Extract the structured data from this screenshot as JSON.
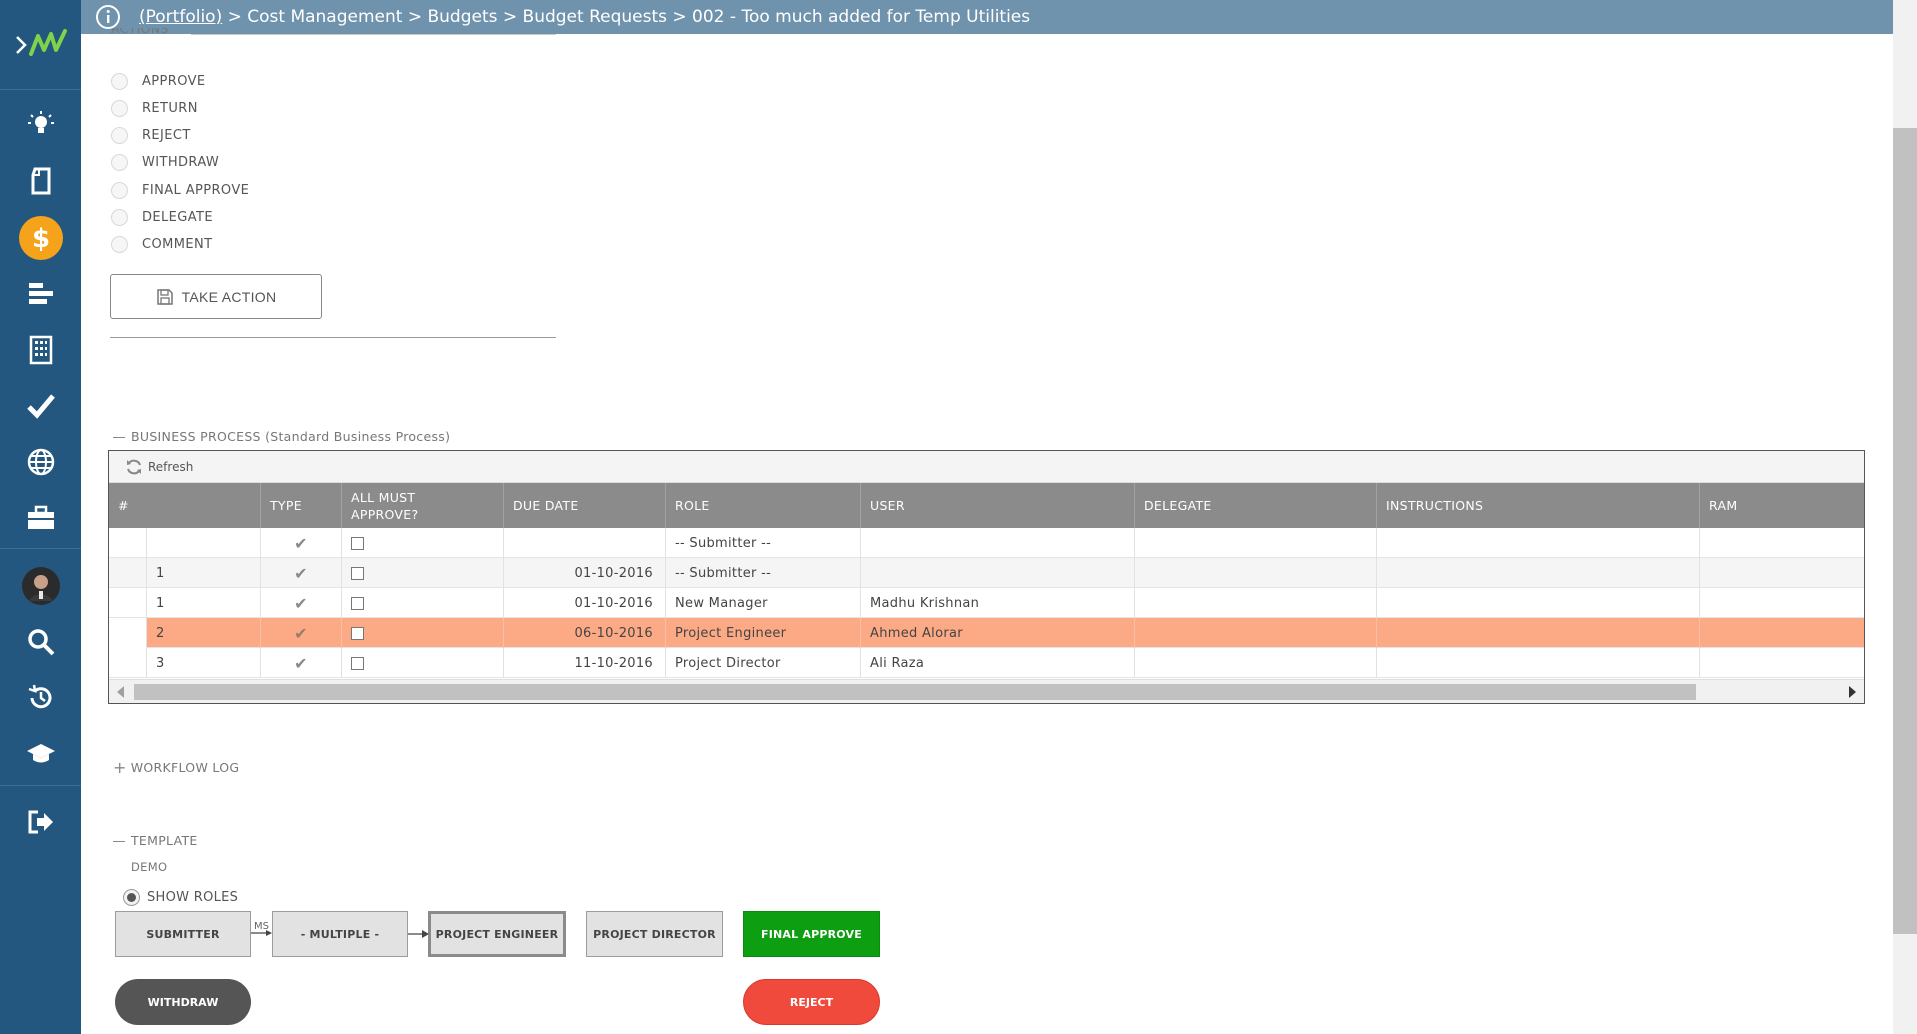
{
  "header": {
    "breadcrumb_link": "(Portfolio)",
    "breadcrumb_rest": " > Cost Management > Budgets > Budget Requests > 002 - Too much added for Temp Utilities"
  },
  "sidebar": {
    "items": [
      "logo-icon",
      "lightbulb-icon",
      "document-icon",
      "dollar-icon",
      "gantt-icon",
      "building-icon",
      "check-icon",
      "globe-icon",
      "briefcase-icon",
      "avatar",
      "search-icon",
      "history-icon",
      "graduation-cap-icon",
      "logout-icon"
    ],
    "accent": "#f5a31a"
  },
  "actions": {
    "section_label": "ACTIONS",
    "options": [
      "APPROVE",
      "RETURN",
      "REJECT",
      "WITHDRAW",
      "FINAL APPROVE",
      "DELEGATE",
      "COMMENT"
    ],
    "take_action_label": "TAKE ACTION"
  },
  "business_process": {
    "section_label": "BUSINESS PROCESS (Standard Business Process)",
    "refresh_label": "Refresh",
    "columns": [
      "#",
      "TYPE",
      "ALL MUST APPROVE?",
      "DUE DATE",
      "ROLE",
      "USER",
      "DELEGATE",
      "INSTRUCTIONS",
      "RAM"
    ],
    "rows": [
      {
        "num": "",
        "type": "✔",
        "due": "",
        "role": "-- Submitter --",
        "user": ""
      },
      {
        "num": "1",
        "type": "✔",
        "due": "01-10-2016",
        "role": "-- Submitter --",
        "user": ""
      },
      {
        "num": "1",
        "type": "✔",
        "due": "01-10-2016",
        "role": "New Manager",
        "user": "Madhu Krishnan"
      },
      {
        "num": "2",
        "type": "✔",
        "due": "06-10-2016",
        "role": "Project Engineer",
        "user": "Ahmed Alorar"
      },
      {
        "num": "3",
        "type": "✔",
        "due": "11-10-2016",
        "role": "Project Director",
        "user": "Ali Raza"
      }
    ],
    "selected_row_color": "#fca986"
  },
  "workflow_log": {
    "section_label": "WORKFLOW LOG"
  },
  "template": {
    "section_label": "TEMPLATE",
    "sub_label": "DEMO",
    "show_roles_label": "SHOW ROLES",
    "flow": [
      "SUBMITTER",
      "- MULTIPLE -",
      "PROJECT ENGINEER",
      "PROJECT DIRECTOR",
      "FINAL APPROVE"
    ],
    "connector_label": "MS",
    "withdraw_label": "WITHDRAW",
    "reject_label": "REJECT",
    "colors": {
      "final": "#0e9e12",
      "withdraw": "#555555",
      "reject": "#f04a3c"
    }
  }
}
